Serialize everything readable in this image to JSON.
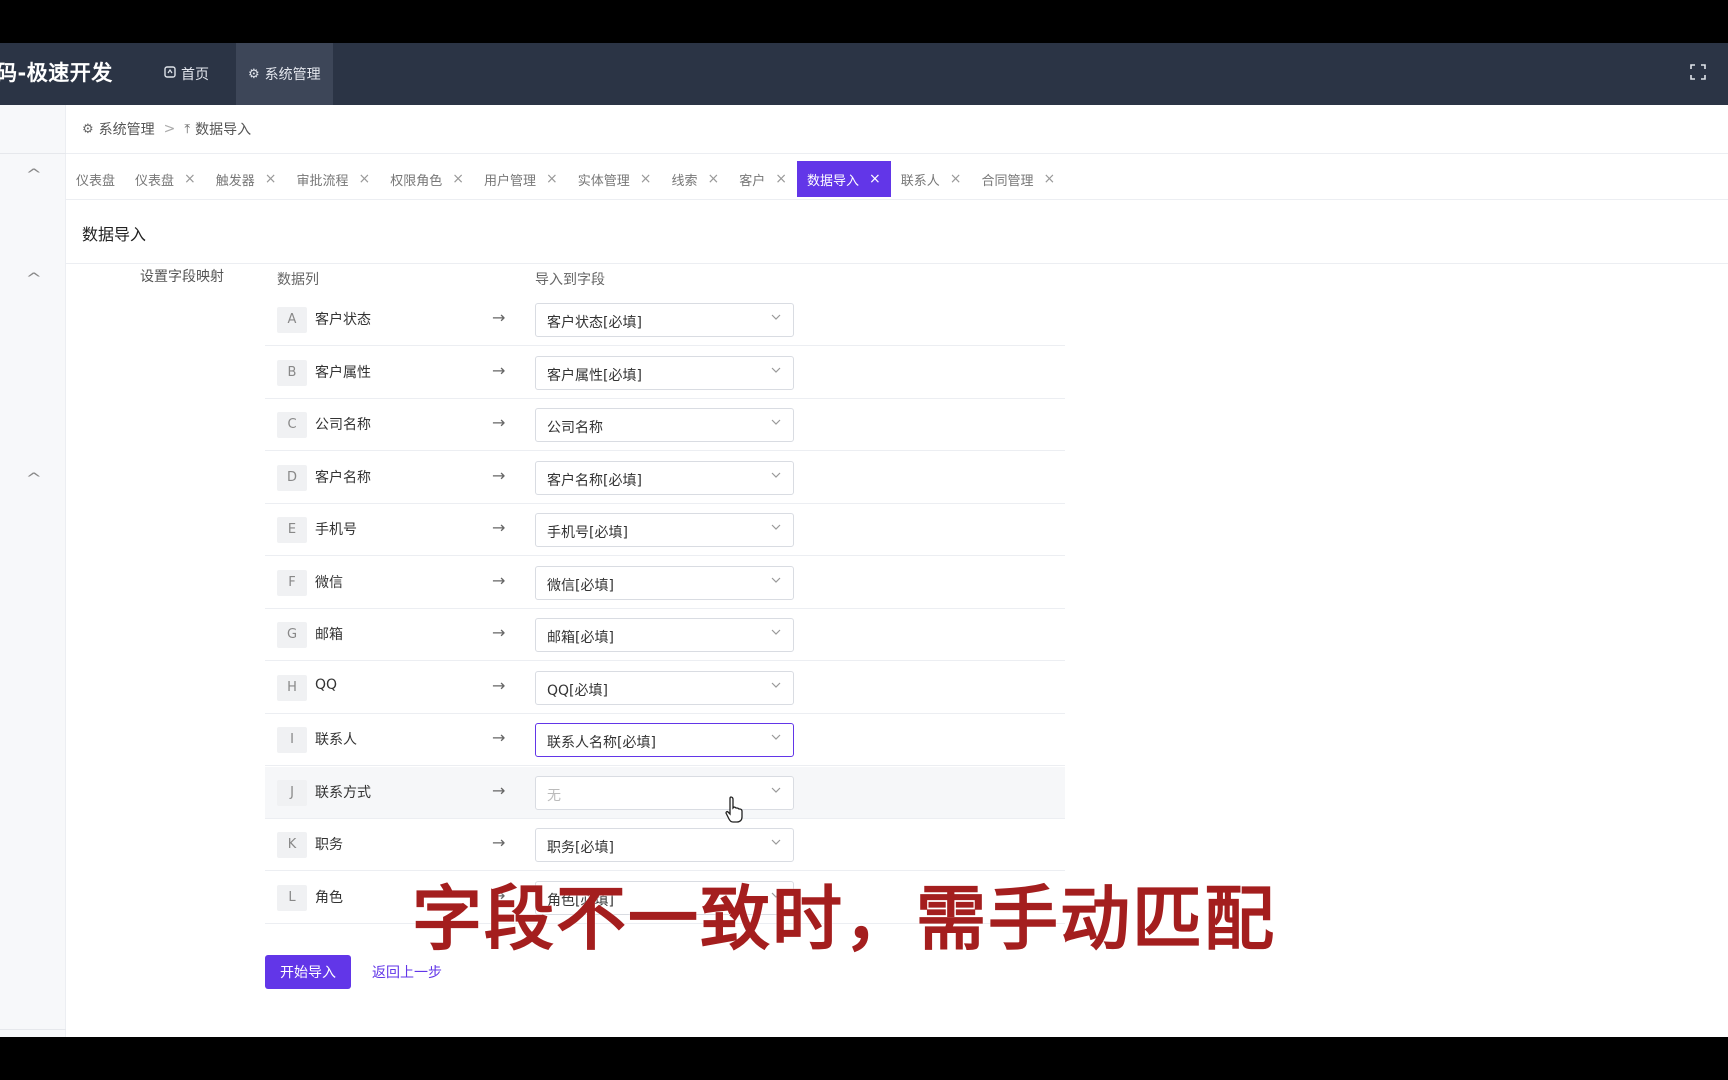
{
  "header": {
    "app_title": "码-极速开发",
    "nav": [
      {
        "label": "首页",
        "icon": "dashboard-icon"
      },
      {
        "label": "系统管理",
        "icon": "gear-icon"
      }
    ],
    "fullscreen_icon": "fullscreen-icon"
  },
  "breadcrumb": [
    {
      "label": "系统管理",
      "icon": "gear-icon"
    },
    {
      "label": "数据导入",
      "icon": "upload-icon"
    }
  ],
  "tabs": [
    {
      "label": "仪表盘",
      "closable": false
    },
    {
      "label": "仪表盘",
      "closable": true
    },
    {
      "label": "触发器",
      "closable": true
    },
    {
      "label": "审批流程",
      "closable": true
    },
    {
      "label": "权限角色",
      "closable": true
    },
    {
      "label": "用户管理",
      "closable": true
    },
    {
      "label": "实体管理",
      "closable": true
    },
    {
      "label": "线索",
      "closable": true
    },
    {
      "label": "客户",
      "closable": true
    },
    {
      "label": "数据导入",
      "closable": true,
      "active": true
    },
    {
      "label": "联系人",
      "closable": true
    },
    {
      "label": "合同管理",
      "closable": true
    }
  ],
  "tab_close_glyph": "×",
  "page": {
    "title": "数据导入",
    "section_label": "设置字段映射",
    "col_data": "数据列",
    "col_field": "导入到字段",
    "rows": [
      {
        "letter": "A",
        "column": "客户状态",
        "field": "客户状态[必填]"
      },
      {
        "letter": "B",
        "column": "客户属性",
        "field": "客户属性[必填]"
      },
      {
        "letter": "C",
        "column": "公司名称",
        "field": "公司名称"
      },
      {
        "letter": "D",
        "column": "客户名称",
        "field": "客户名称[必填]"
      },
      {
        "letter": "E",
        "column": "手机号",
        "field": "手机号[必填]"
      },
      {
        "letter": "F",
        "column": "微信",
        "field": "微信[必填]"
      },
      {
        "letter": "G",
        "column": "邮箱",
        "field": "邮箱[必填]"
      },
      {
        "letter": "H",
        "column": "QQ",
        "field": "QQ[必填]"
      },
      {
        "letter": "I",
        "column": "联系人",
        "field": "联系人名称[必填]",
        "state": "focused"
      },
      {
        "letter": "J",
        "column": "联系方式",
        "field": "无",
        "state": "empty"
      },
      {
        "letter": "K",
        "column": "职务",
        "field": "职务[必填]"
      },
      {
        "letter": "L",
        "column": "角色",
        "field": "角色[必填]"
      }
    ],
    "start_button": "开始导入",
    "back_link": "返回上一步"
  },
  "video_subtitle": "字段不一致时，需手动匹配",
  "colors": {
    "header_bg": "#2b3445",
    "accent": "#6236e8",
    "subtitle": "#a41e1e"
  }
}
